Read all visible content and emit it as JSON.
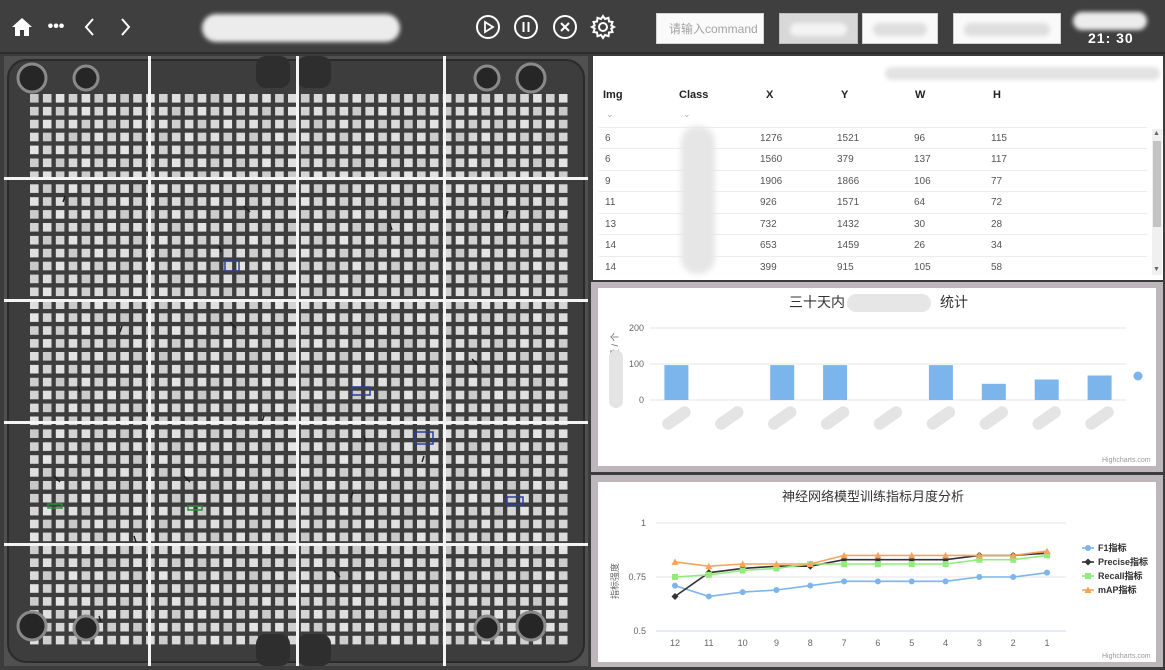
{
  "topbar": {
    "home_icon": "home-icon",
    "more_label": "•••",
    "back_label": "‹",
    "forward_label": "›",
    "command_placeholder": "请输入command",
    "clock": "21: 30"
  },
  "table": {
    "columns": [
      "Img",
      "Class",
      "X",
      "Y",
      "W",
      "H"
    ],
    "rows": [
      {
        "img": "6",
        "x": "1276",
        "y": "1521",
        "w": "96",
        "h": "115"
      },
      {
        "img": "6",
        "x": "1560",
        "y": "379",
        "w": "137",
        "h": "117"
      },
      {
        "img": "9",
        "x": "1906",
        "y": "1866",
        "w": "106",
        "h": "77"
      },
      {
        "img": "11",
        "x": "926",
        "y": "1571",
        "w": "64",
        "h": "72"
      },
      {
        "img": "13",
        "x": "732",
        "y": "1432",
        "w": "30",
        "h": "28"
      },
      {
        "img": "14",
        "x": "653",
        "y": "1459",
        "w": "26",
        "h": "34"
      },
      {
        "img": "14",
        "x": "399",
        "y": "915",
        "w": "105",
        "h": "58"
      }
    ]
  },
  "chart_data": [
    {
      "type": "bar",
      "title_left": "三十天内",
      "title_right": "统计",
      "ylabel_fragment": "量 / 个",
      "ylim": [
        0,
        200
      ],
      "yticks": [
        0,
        100,
        200
      ],
      "values": [
        97,
        0,
        97,
        97,
        0,
        97,
        45,
        57,
        68
      ],
      "color": "#7cb5ec",
      "credit": "Highcharts.com",
      "grid": true
    },
    {
      "type": "line",
      "title": "神经网络模型训练指标月度分析",
      "ylabel": "指标强度",
      "categories": [
        "12",
        "11",
        "10",
        "9",
        "8",
        "7",
        "6",
        "5",
        "4",
        "3",
        "2",
        "1"
      ],
      "ylim": [
        0.5,
        1
      ],
      "yticks": [
        "0.5",
        "0.75",
        "1"
      ],
      "legend_position": "right",
      "credit": "Highcharts.com",
      "series": [
        {
          "name": "F1指标",
          "color": "#7cb5ec",
          "marker": "circle",
          "values": [
            0.71,
            0.66,
            0.68,
            0.69,
            0.71,
            0.73,
            0.73,
            0.73,
            0.73,
            0.75,
            0.75,
            0.77
          ]
        },
        {
          "name": "Precise指标",
          "color": "#333333",
          "marker": "diamond",
          "values": [
            0.66,
            0.77,
            0.79,
            0.8,
            0.8,
            0.83,
            0.83,
            0.83,
            0.83,
            0.85,
            0.85,
            0.86
          ]
        },
        {
          "name": "Recall指标",
          "color": "#90ed7d",
          "marker": "square",
          "values": [
            0.75,
            0.76,
            0.78,
            0.79,
            0.81,
            0.81,
            0.81,
            0.81,
            0.81,
            0.83,
            0.83,
            0.85
          ]
        },
        {
          "name": "mAP指标",
          "color": "#f7a35c",
          "marker": "triangle",
          "values": [
            0.82,
            0.8,
            0.81,
            0.81,
            0.81,
            0.85,
            0.85,
            0.85,
            0.85,
            0.85,
            0.85,
            0.87
          ]
        }
      ]
    }
  ]
}
